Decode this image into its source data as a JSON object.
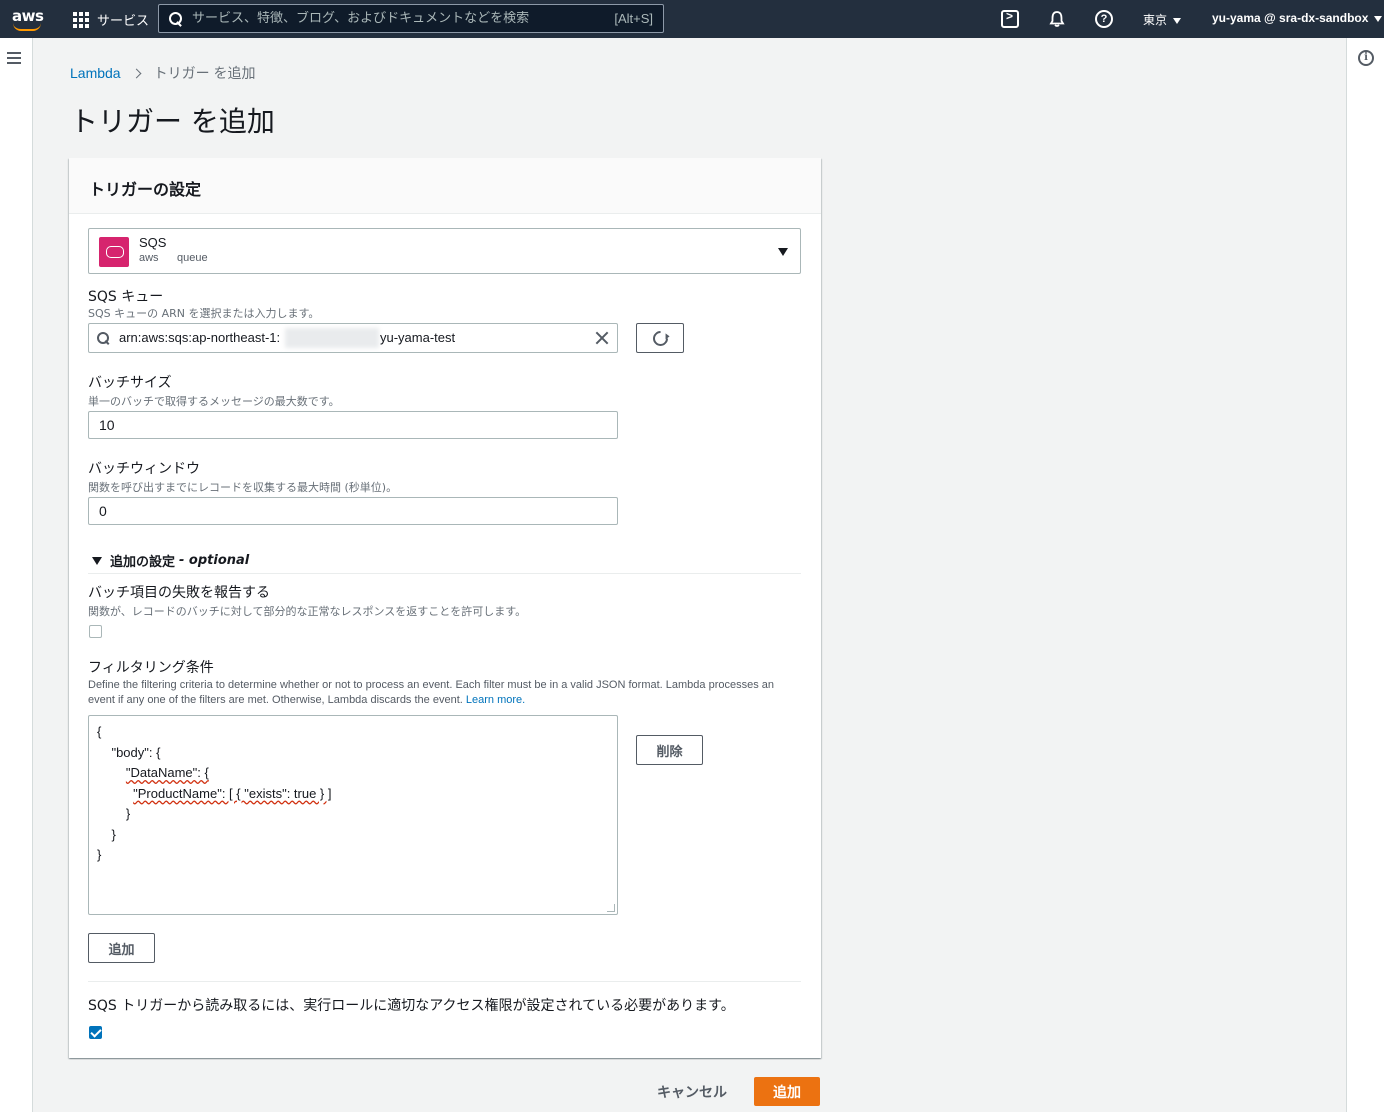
{
  "topnav": {
    "logo_text": "aws",
    "services_label": "サービス",
    "search_placeholder": "サービス、特徴、ブログ、およびドキュメントなどを検索",
    "search_shortcut": "[Alt+S]",
    "help_glyph": "?",
    "region": "東京",
    "account": "yu-yama @ sra-dx-sandbox"
  },
  "breadcrumb": {
    "root": "Lambda",
    "current": "トリガー を追加"
  },
  "page_title": "トリガー を追加",
  "panel": {
    "title": "トリガーの設定",
    "source": {
      "name": "SQS",
      "tags": [
        "aws",
        "queue"
      ],
      "icon": "sqs-icon",
      "icon_color": "#d6246e"
    },
    "queue": {
      "label": "SQS キュー",
      "description": "SQS キューの ARN を選択または入力します。",
      "value_prefix": "arn:aws:sqs:ap-northeast-1:",
      "value_suffix": "yu-yama-test"
    },
    "batch_size": {
      "label": "バッチサイズ",
      "description": "単一のバッチで取得するメッセージの最大数です。",
      "value": "10"
    },
    "batch_window": {
      "label": "バッチウィンドウ",
      "description": "関数を呼び出すまでにレコードを収集する最大時間 (秒単位)。",
      "value": "0"
    },
    "additional": {
      "title": "追加の設定",
      "optional": "- optional"
    },
    "report_failures": {
      "label": "バッチ項目の失敗を報告する",
      "description": "関数が、レコードのバッチに対して部分的な正常なレスポンスを返すことを許可します。",
      "checked": false
    },
    "filter": {
      "label": "フィルタリング条件",
      "description": "Define the filtering criteria to determine whether or not to process an event. Each filter must be in a valid JSON format. Lambda processes an event if any one of the filters are met. Otherwise, Lambda discards the event.",
      "learn_more": "Learn more.",
      "code_lines": [
        "{",
        "\"body\": {",
        "\"DataName\": {",
        "\"ProductName\": [ { \"exists\": true } ]",
        "}",
        "}",
        "}"
      ],
      "delete_label": "削除",
      "add_label": "追加"
    },
    "permission_note": "SQS トリガーから読み取るには、実行ロールに適切なアクセス権限が設定されている必要があります。",
    "permission_checked": true
  },
  "footer": {
    "cancel_label": "キャンセル",
    "add_label": "追加"
  },
  "colors": {
    "nav_bg": "#232f3e",
    "primary": "#ec7211",
    "link": "#0073bb"
  }
}
